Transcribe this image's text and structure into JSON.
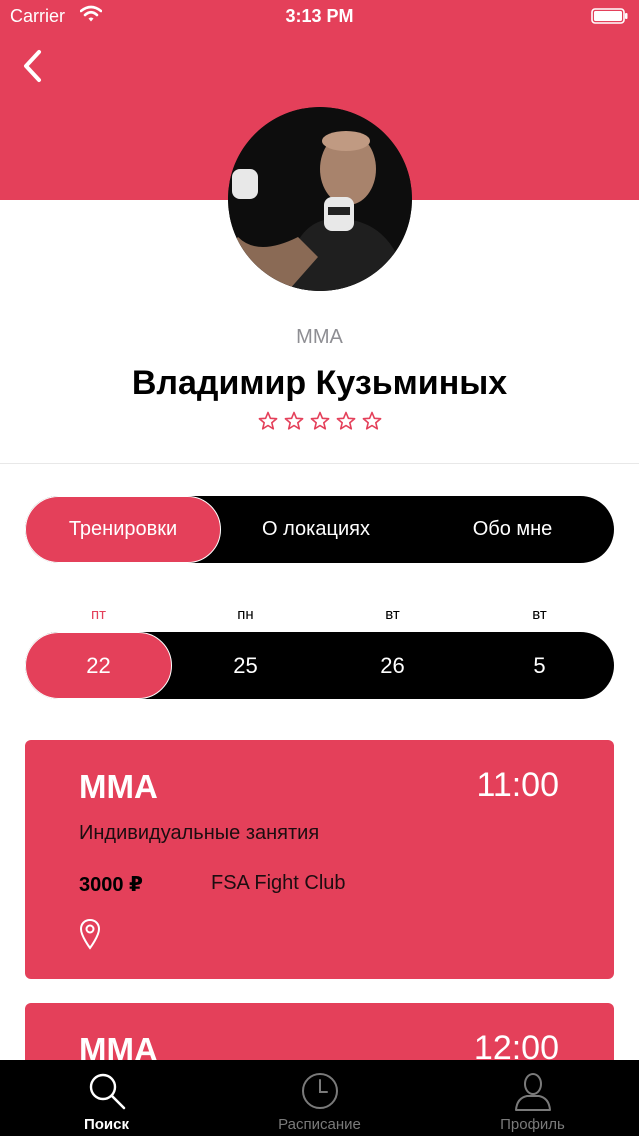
{
  "status_bar": {
    "carrier": "Carrier",
    "time": "3:13 PM"
  },
  "colors": {
    "accent": "#e4405a",
    "dark": "#000000",
    "muted": "#8e8e93"
  },
  "profile": {
    "sport": "MMA",
    "name": "Владимир Кузьминых",
    "rating": 0,
    "rating_max": 5
  },
  "segments": [
    {
      "label": "Тренировки",
      "active": true
    },
    {
      "label": "О локациях",
      "active": false
    },
    {
      "label": "Обо мне",
      "active": false
    }
  ],
  "days": [
    {
      "weekday": "пт",
      "date": "22",
      "active": true
    },
    {
      "weekday": "пн",
      "date": "25",
      "active": false
    },
    {
      "weekday": "вт",
      "date": "26",
      "active": false
    },
    {
      "weekday": "вт",
      "date": "5",
      "active": false
    }
  ],
  "trainings": [
    {
      "title": "MMA",
      "time": "11:00",
      "type": "Индивидуальные занятия",
      "price": "3000 ₽",
      "club": "FSA Fight Club",
      "icon": "location-pin-icon"
    },
    {
      "title": "MMA",
      "time": "12:00"
    }
  ],
  "tabbar": [
    {
      "label": "Поиск",
      "icon": "search-icon",
      "active": true
    },
    {
      "label": "Расписание",
      "icon": "clock-icon",
      "active": false
    },
    {
      "label": "Профиль",
      "icon": "person-icon",
      "active": false
    }
  ]
}
